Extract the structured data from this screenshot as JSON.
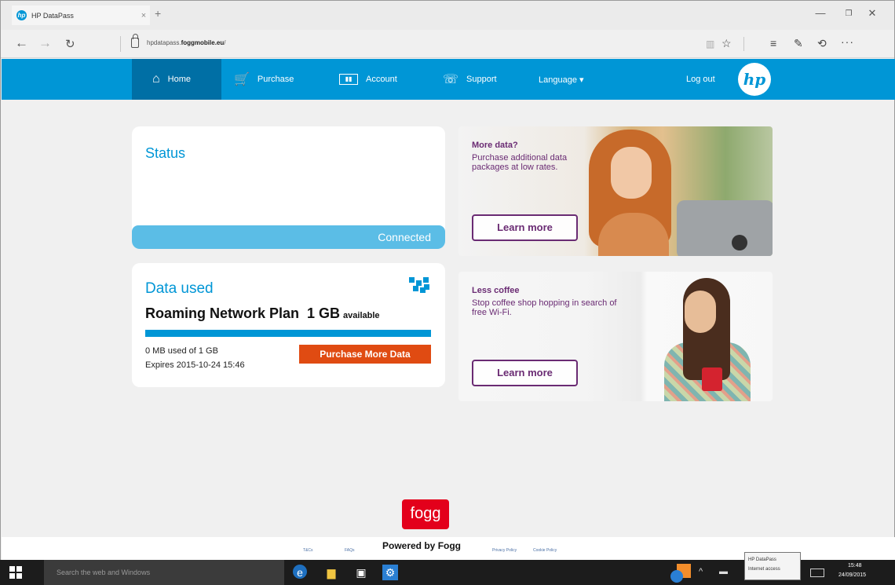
{
  "browser": {
    "tab_title": "HP DataPass",
    "tab_close": "×",
    "new_tab": "+",
    "address_prefix": "hpdatapass.",
    "address_host": "foggmobile.eu",
    "address_suffix": "/"
  },
  "site": {
    "nav": {
      "home": "Home",
      "purchase": "Purchase",
      "account": "Account",
      "support": "Support",
      "language": "Language ▾",
      "logout": "Log out"
    },
    "logo_text": "hp"
  },
  "status": {
    "title": "Status",
    "state": "Connected"
  },
  "data_used": {
    "title": "Data used",
    "plan_name": "Roaming Network Plan",
    "amount": "1 GB",
    "available_label": "available",
    "usage_fraction": 0,
    "used_text": "0 MB used of 1 GB",
    "expires_text": "Expires 2015-10-24 15:46",
    "purchase_button": "Purchase More Data"
  },
  "promos": [
    {
      "heading": "More data?",
      "body": "Purchase additional data packages at low rates.",
      "button": "Learn more"
    },
    {
      "heading": "Less coffee",
      "body": "Stop coffee shop hopping in search of free Wi-Fi.",
      "button": "Learn more"
    }
  ],
  "footer": {
    "logo": "fogg",
    "powered_by": "Powered by Fogg",
    "links": [
      "T&Cs",
      "FAQs",
      "Privacy Policy",
      "Cookie Policy"
    ]
  },
  "taskbar": {
    "search_placeholder": "Search the web and Windows",
    "tooltip_line1": "HP DataPass",
    "tooltip_line2": "Internet access",
    "time": "15:48",
    "date": "24/09/2015"
  },
  "colors": {
    "brand_blue": "#0096d6",
    "active_menu": "#006fa5",
    "purchase_orange": "#e04b12",
    "promo_purple": "#6a2b73",
    "fogg_red": "#e3001b"
  }
}
